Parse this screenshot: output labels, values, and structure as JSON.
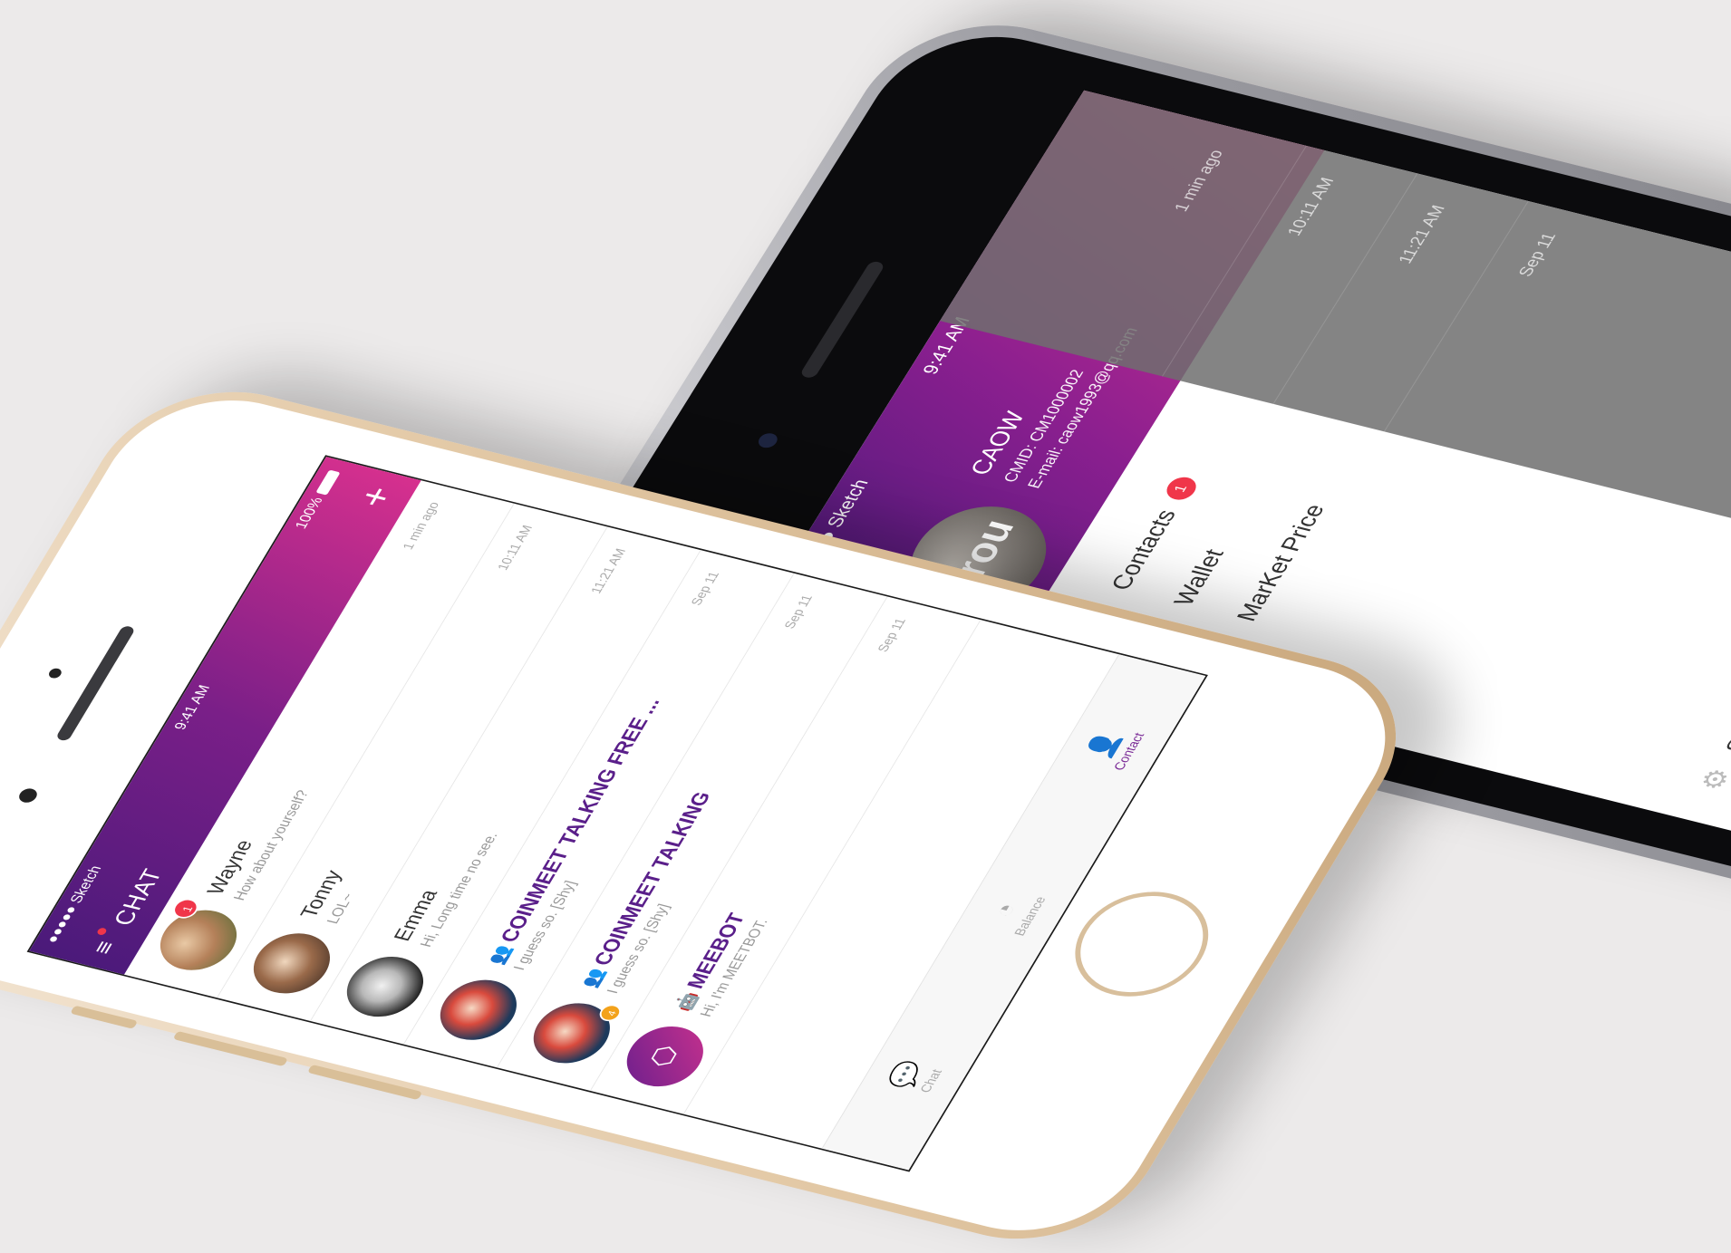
{
  "back_phone": {
    "status": {
      "carrier": "●●●●● Sketch",
      "time": "9:41 AM"
    },
    "profile": {
      "avatar_text": "grou",
      "name": "CAOW",
      "cmid": "CMID: CM1000002",
      "email": "E-mail: caow1993@qq.com"
    },
    "menu": [
      {
        "label": "Contacts",
        "badge": "1",
        "icon": "contacts-icon"
      },
      {
        "label": "Wallet",
        "icon": "wallet-icon"
      },
      {
        "label": "MarKet Price",
        "icon": "market-chart-icon"
      }
    ],
    "settings_label": "Settings",
    "overlay_times": [
      "1 min ago",
      "10:11 AM",
      "11:21 AM",
      "Sep 11"
    ]
  },
  "front_phone": {
    "status": {
      "carrier": "●●●●● Sketch",
      "time": "9:41 AM",
      "battery": "100%"
    },
    "header": {
      "title": "CHAT",
      "add_symbol": "+"
    },
    "chats": [
      {
        "name": "Wayne",
        "message": "How about yourself?",
        "time": "1 min ago",
        "badge": "1",
        "avatar": "av-wayne",
        "group": false
      },
      {
        "name": "Tonny",
        "message": "LOL~",
        "time": "10:11 AM",
        "avatar": "av-tonny",
        "group": false
      },
      {
        "name": "Emma",
        "message": "Hi, Long time no see.",
        "time": "11:21 AM",
        "avatar": "av-emma",
        "group": false
      },
      {
        "name": "COINMEET TALKING FREE ...",
        "message": "I guess so. [Shy]",
        "time": "Sep 11",
        "avatar": "av-coin",
        "group": true
      },
      {
        "name": "COINMEET TALKING",
        "message": "I guess so. [Shy]",
        "time": "Sep 11",
        "avatar": "av-coin",
        "group": true,
        "mini_badge": "4"
      },
      {
        "name": "MEEBOT",
        "message": "Hi, I'm MEETBOT.",
        "time": "Sep 11",
        "avatar": "av-meebot",
        "group": true,
        "bot": true
      }
    ],
    "tabs": [
      {
        "label": "Chat",
        "icon": "chat-bubble-icon",
        "glyph": "💬",
        "active": false
      },
      {
        "label": "Balance",
        "icon": "pie-chart-icon",
        "glyph": "◔",
        "active": false
      },
      {
        "label": "Contact",
        "icon": "contact-icon",
        "glyph": "👤",
        "active": true
      }
    ]
  },
  "colors": {
    "header_start": "#4a1a7a",
    "header_end": "#d7308e",
    "accent": "#7a2a96",
    "badge": "#f0364a"
  }
}
